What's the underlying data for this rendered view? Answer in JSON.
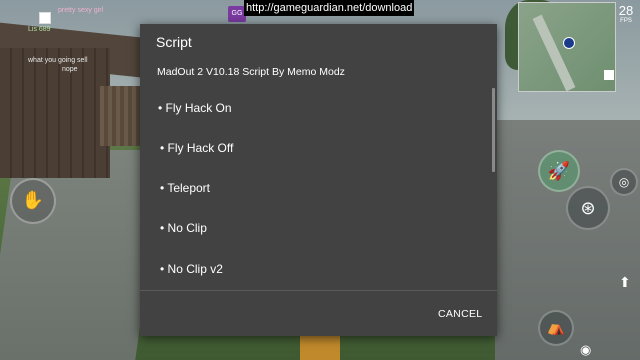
{
  "overlay": {
    "url": "http://gameguardian.net/download",
    "gg_logo": "GG"
  },
  "dialog": {
    "title": "Script",
    "subtitle": "MadOut 2 V10.18 Script By Memo Modz",
    "items": [
      {
        "label": "• Fly Hack On"
      },
      {
        "label": "• Fly Hack Off"
      },
      {
        "label": "• Teleport"
      },
      {
        "label": "• No Clip"
      },
      {
        "label": "• No Clip v2"
      }
    ],
    "cancel_label": "CANCEL"
  },
  "hud": {
    "fps_value": "28",
    "fps_label": "FPS",
    "chat": [
      "pretty sexy girl",
      "Lis 689",
      "what you going sell",
      "nope"
    ]
  },
  "colors": {
    "dialog_bg": "#424242",
    "text": "#ffffff",
    "url_banner_bg": "#000000"
  },
  "icons": [
    "joystick-icon",
    "rocket-icon",
    "steering-wheel-icon",
    "crosshair-icon",
    "seat-icon",
    "arrow-up-icon",
    "eye-icon"
  ]
}
